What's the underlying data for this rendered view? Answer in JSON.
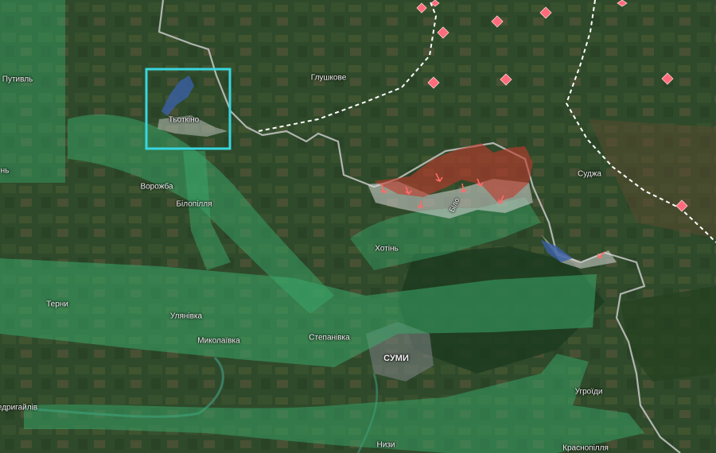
{
  "map": {
    "colors": {
      "terrain_base": "#2f4a2c",
      "ua_corridor": "#3aa86a",
      "occupied": "#c0392b",
      "contested": "#d9d9d9",
      "focus_frame": "#38d6e0",
      "border": "#c8c8c8",
      "frontline": "#ffffff",
      "attack_marker": "#ff6b6b"
    },
    "labels": {
      "putyvl": "Путивль",
      "hlushkove": "Глушкове",
      "tiotkino": "Тьоткіно",
      "vorozhba": "Ворожба",
      "bilopillia": "Білопілля",
      "khotin": "Хотінь",
      "sudzha": "Суджа",
      "terny": "Терни",
      "ulianivka": "Улянівка",
      "mykolaivka": "Миколаївка",
      "stepanivka": "Степанівка",
      "sumy": "СУМИ",
      "uhroidy": "Угроїди",
      "nyzy": "Низи",
      "krasnopillia": "Краснопілля",
      "vedryhailiv": "едригайлів",
      "edge_nh": "нь",
      "bilovody": "Біло"
    },
    "focus_frame_label": "",
    "markers": {
      "attack_arrows": 8,
      "russian_positions": 12
    }
  }
}
